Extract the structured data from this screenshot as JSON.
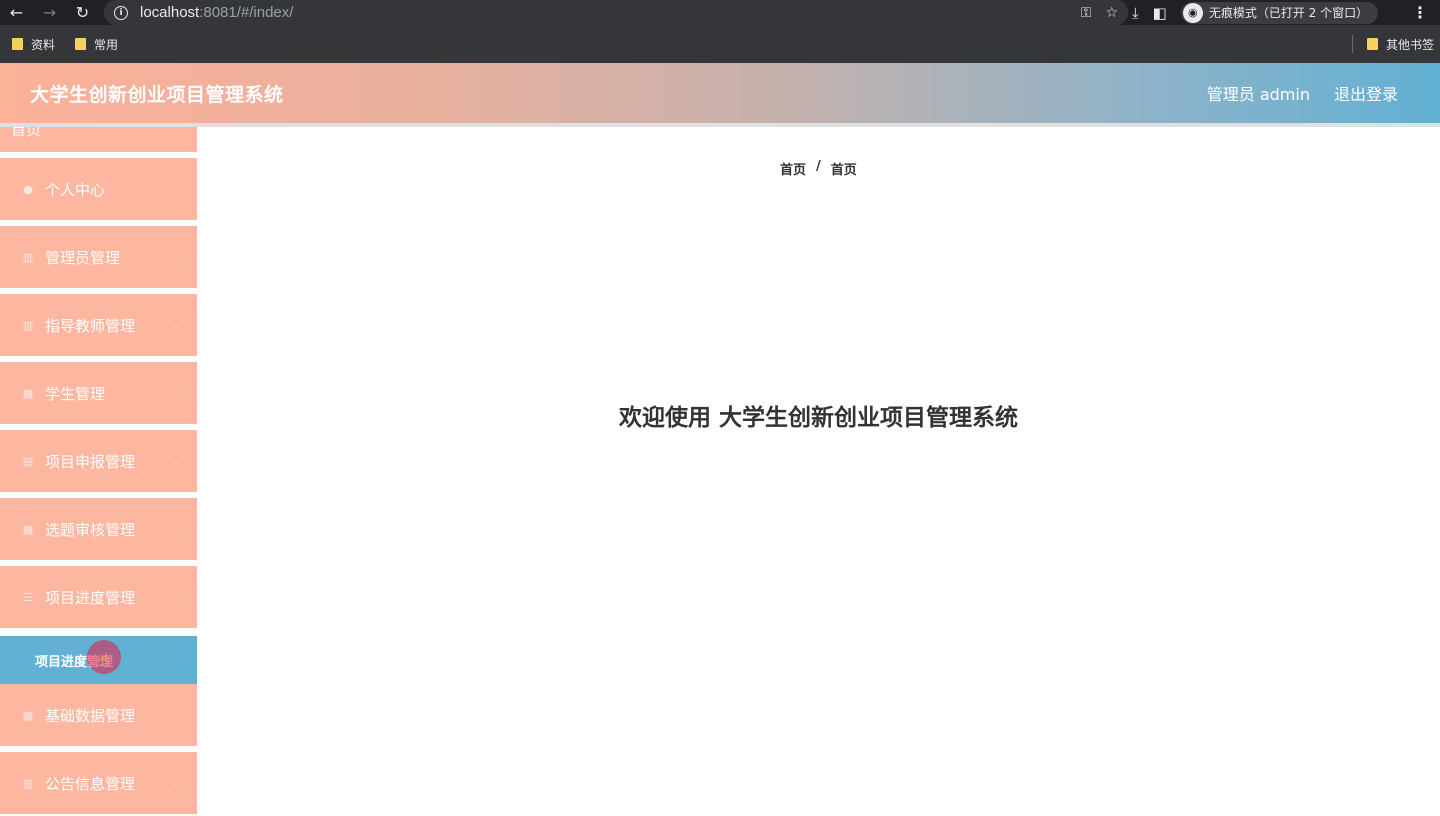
{
  "browser": {
    "url_host": "localhost",
    "url_rest": ":8081/#/index/",
    "incognito_label": "无痕模式（已打开 2 个窗口）",
    "bookmarks": [
      "资料",
      "常用"
    ],
    "other_bookmarks": "其他书签"
  },
  "header": {
    "title": "大学生创新创业项目管理系统",
    "user_label": "管理员 admin",
    "logout_label": "退出登录"
  },
  "sidebar": {
    "items": [
      {
        "label": "首页",
        "icon": "home-icon"
      },
      {
        "label": "个人中心",
        "icon": "user-icon"
      },
      {
        "label": "管理员管理",
        "icon": "grid-icon"
      },
      {
        "label": "指导教师管理",
        "icon": "grid-icon"
      },
      {
        "label": "学生管理",
        "icon": "chart-icon"
      },
      {
        "label": "项目申报管理",
        "icon": "doc-icon"
      },
      {
        "label": "选题审核管理",
        "icon": "chart-icon"
      },
      {
        "label": "项目进度管理",
        "icon": "list-icon"
      },
      {
        "label": "基础数据管理",
        "icon": "chart-icon"
      },
      {
        "label": "公告信息管理",
        "icon": "grid-icon"
      }
    ],
    "active_sub_item": "项目进度管理"
  },
  "breadcrumb": [
    "首页",
    "首页"
  ],
  "welcome_text": "欢迎使用 大学生创新创业项目管理系统"
}
